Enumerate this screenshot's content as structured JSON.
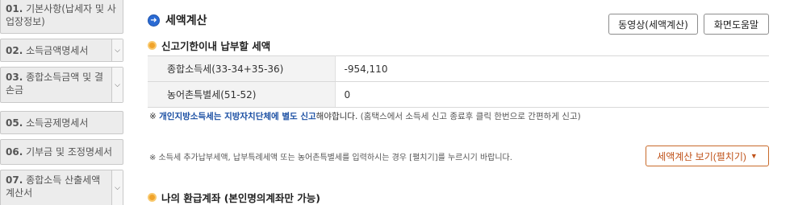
{
  "sidebar": {
    "items": [
      {
        "num": "01.",
        "label": "기본사항(납세자 및 사업장정보)",
        "arrow": false
      },
      {
        "num": "02.",
        "label": "소득금액명세서",
        "arrow": true
      },
      {
        "num": "03.",
        "label": "종합소득금액 및 결손금",
        "arrow": true
      },
      {
        "num": "05.",
        "label": "소득공제명세서",
        "arrow": false
      },
      {
        "num": "06.",
        "label": "기부금 및 조정명세서",
        "arrow": false
      },
      {
        "num": "07.",
        "label": "종합소득 산출세액계산서",
        "arrow": true
      }
    ]
  },
  "main": {
    "title": "세액계산",
    "buttons": {
      "video": "동영상(세액계산)",
      "help": "화면도움말"
    },
    "section1_title": "신고기한이내 납부할 세액",
    "rows": [
      {
        "label": "종합소득세(33-34+35-36)",
        "value": "-954,110"
      },
      {
        "label": "농어촌특별세(51-52)",
        "value": "0"
      }
    ],
    "note1": {
      "prefix": "※ ",
      "bold1": "개인지방소득세는 지방자치단체에 별도 신고",
      "mid": "해야합니다. ",
      "rest": "(홈택스에서 소득세 신고 종료후 클릭 한번으로 간편하게 신고)"
    },
    "note2": "※ 소득세 추가납부세액, 납부특례세액 또는 농어촌특별세를 입력하시는 경우 [펼치기]를 누르시기 바랍니다.",
    "expand_button": "세액계산 보기(펼치기)",
    "section2_title": "나의 환급계좌 (본인명의계좌만 가능)"
  }
}
